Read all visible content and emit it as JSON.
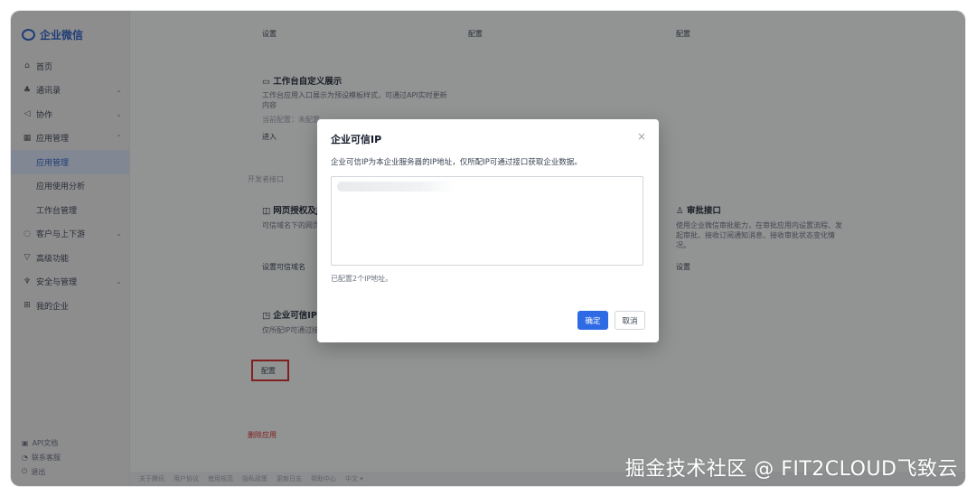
{
  "sidebar": {
    "logo": "企业微信",
    "items": [
      {
        "label": "首页",
        "icon": "home-icon",
        "glyph": "⌂",
        "chevron": ""
      },
      {
        "label": "通讯录",
        "icon": "contacts-icon",
        "glyph": "♣",
        "chevron": "⌄"
      },
      {
        "label": "协作",
        "icon": "collab-icon",
        "glyph": "◁",
        "chevron": "⌄"
      },
      {
        "label": "应用管理",
        "icon": "apps-icon",
        "glyph": "▦",
        "chevron": "⌃"
      },
      {
        "label": "应用管理",
        "icon": "",
        "glyph": "",
        "chevron": "",
        "sub": true,
        "active": true
      },
      {
        "label": "应用使用分析",
        "icon": "",
        "glyph": "",
        "chevron": "",
        "sub": true
      },
      {
        "label": "工作台管理",
        "icon": "",
        "glyph": "",
        "chevron": "",
        "sub": true
      },
      {
        "label": "客户与上下游",
        "icon": "customer-icon",
        "glyph": "◌",
        "chevron": "⌄"
      },
      {
        "label": "高级功能",
        "icon": "advanced-icon",
        "glyph": "▽",
        "chevron": ""
      },
      {
        "label": "安全与管理",
        "icon": "security-icon",
        "glyph": "♆",
        "chevron": "⌄"
      },
      {
        "label": "我的企业",
        "icon": "company-icon",
        "glyph": "⊞",
        "chevron": ""
      }
    ],
    "footer": [
      {
        "label": "API文档",
        "icon": "doc-icon",
        "glyph": "▣"
      },
      {
        "label": "联系客服",
        "icon": "service-icon",
        "glyph": "◔"
      },
      {
        "label": "退出",
        "icon": "logout-icon",
        "glyph": "⏻"
      }
    ]
  },
  "main": {
    "col_settings": "设置",
    "col_config_1": "配置",
    "col_config_2": "配置",
    "workbench_title": "工作台自定义展示",
    "workbench_desc": "工作台应用入口展示为预设模板样式，可通过API实时更新内容",
    "workbench_status": "当前配置：未配置",
    "enter": "进入",
    "dev_api": "开发者接口",
    "web_auth_title": "网页授权及JS",
    "web_auth_desc": "可信域名下的网页可",
    "approval_title": "审批接口",
    "approval_desc": "使用企业微信审批能力，在审批应用内设置流程、发起审批、接收订阅通知消息、接收审批状态变化情况。",
    "set_domain": "设置可信域名",
    "approval_setting": "设置",
    "trusted_ip_title": "企业可信IP",
    "trusted_ip_desc": "仅所配IP可通过接口",
    "config_button": "配置",
    "delete_app": "删除应用",
    "bottom_links": [
      "关于腾讯",
      "用户协议",
      "使用规范",
      "隐私政策",
      "更新日志",
      "帮助中心",
      "中文 ▾"
    ]
  },
  "dialog": {
    "title": "企业可信IP",
    "message": "企业可信IP为本企业服务器的IP地址，仅所配IP可通过接口获取企业数据。",
    "ip_count_text": "已配置2个IP地址。",
    "ok": "确定",
    "cancel": "取消",
    "close_glyph": "×"
  },
  "watermark": "掘金技术社区 @ FIT2CLOUD飞致云",
  "colors": {
    "primary": "#2d6ae3",
    "danger": "#d92b2b",
    "overlay": "rgba(20,20,20,0.45)"
  }
}
